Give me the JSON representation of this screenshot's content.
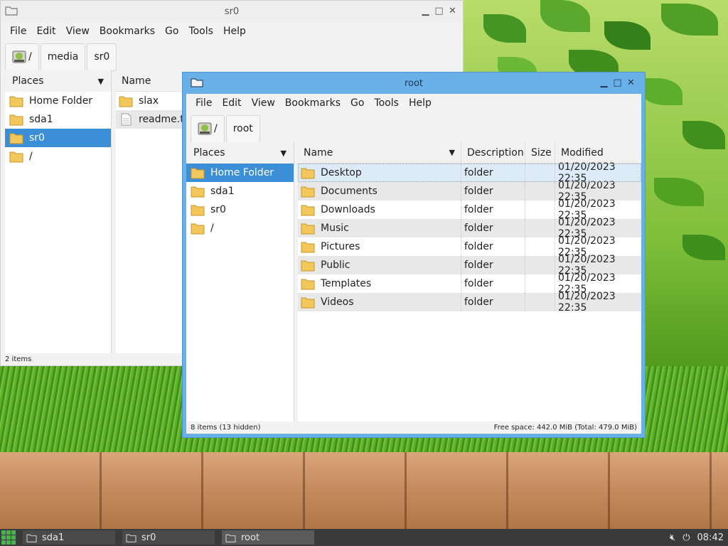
{
  "back_window": {
    "title": "sr0",
    "menu": [
      "File",
      "Edit",
      "View",
      "Bookmarks",
      "Go",
      "Tools",
      "Help"
    ],
    "path": [
      "/",
      "media",
      "sr0"
    ],
    "places_label": "Places",
    "places": [
      "Home Folder",
      "sda1",
      "sr0",
      "/"
    ],
    "selected_place": 2,
    "columns": {
      "name": "Name"
    },
    "files": [
      "slax",
      "readme.txt"
    ],
    "status": "2 items"
  },
  "front_window": {
    "title": "root",
    "menu": [
      "File",
      "Edit",
      "View",
      "Bookmarks",
      "Go",
      "Tools",
      "Help"
    ],
    "path": [
      "/",
      "root"
    ],
    "places_label": "Places",
    "places": [
      "Home Folder",
      "sda1",
      "sr0",
      "/"
    ],
    "selected_place": 0,
    "columns": {
      "name": "Name",
      "description": "Description",
      "size": "Size",
      "modified": "Modified"
    },
    "files": [
      {
        "name": "Desktop",
        "description": "folder",
        "size": "",
        "modified": "01/20/2023 22:35"
      },
      {
        "name": "Documents",
        "description": "folder",
        "size": "",
        "modified": "01/20/2023 22:35"
      },
      {
        "name": "Downloads",
        "description": "folder",
        "size": "",
        "modified": "01/20/2023 22:35"
      },
      {
        "name": "Music",
        "description": "folder",
        "size": "",
        "modified": "01/20/2023 22:35"
      },
      {
        "name": "Pictures",
        "description": "folder",
        "size": "",
        "modified": "01/20/2023 22:35"
      },
      {
        "name": "Public",
        "description": "folder",
        "size": "",
        "modified": "01/20/2023 22:35"
      },
      {
        "name": "Templates",
        "description": "folder",
        "size": "",
        "modified": "01/20/2023 22:35"
      },
      {
        "name": "Videos",
        "description": "folder",
        "size": "",
        "modified": "01/20/2023 22:35"
      }
    ],
    "status_left": "8 items (13 hidden)",
    "status_right": "Free space: 442.0 MiB (Total: 479.0 MiB)"
  },
  "taskbar": {
    "tasks": [
      "sda1",
      "sr0",
      "root"
    ],
    "active_task": 2,
    "clock": "08:42"
  },
  "colors": {
    "accent": "#3b8fd6",
    "titlebar_active": "#6ab0e8",
    "folder": "#f2c75c"
  }
}
